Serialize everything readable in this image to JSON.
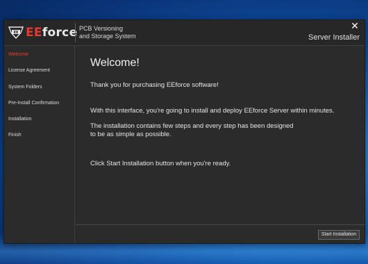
{
  "window": {
    "subtitle_line1": "PCB Versioning",
    "subtitle_line2": "and Storage System",
    "installer_title": "Server Installer",
    "close_glyph": "✕"
  },
  "logo": {
    "brand_prefix": "EE",
    "brand_suffix": "force",
    "badge_text": "EE",
    "icon": "eeforce-logo-icon"
  },
  "sidebar": {
    "items": [
      {
        "label": "Welcome",
        "active": true
      },
      {
        "label": "License Agreement",
        "active": false
      },
      {
        "label": "System Folders",
        "active": false
      },
      {
        "label": "Pre-Install Confirmation",
        "active": false
      },
      {
        "label": "Installation",
        "active": false
      },
      {
        "label": "Finish",
        "active": false
      }
    ]
  },
  "main": {
    "title": "Welcome!",
    "paragraphs": [
      "Thank you for purchasing EEforce software!",
      "With this interface, you're going to install and deploy EEforce Server within minutes.",
      "The installation contains few steps and every step has been designed",
      "to be as simple as possible.",
      "Click Start Installation button when you're ready."
    ]
  },
  "footer": {
    "start_button_label": "Start Installation"
  },
  "colors": {
    "accent": "#ee3b2d",
    "window_bg": "#2b2b2b",
    "desktop_bg": "#0d4a9a"
  }
}
